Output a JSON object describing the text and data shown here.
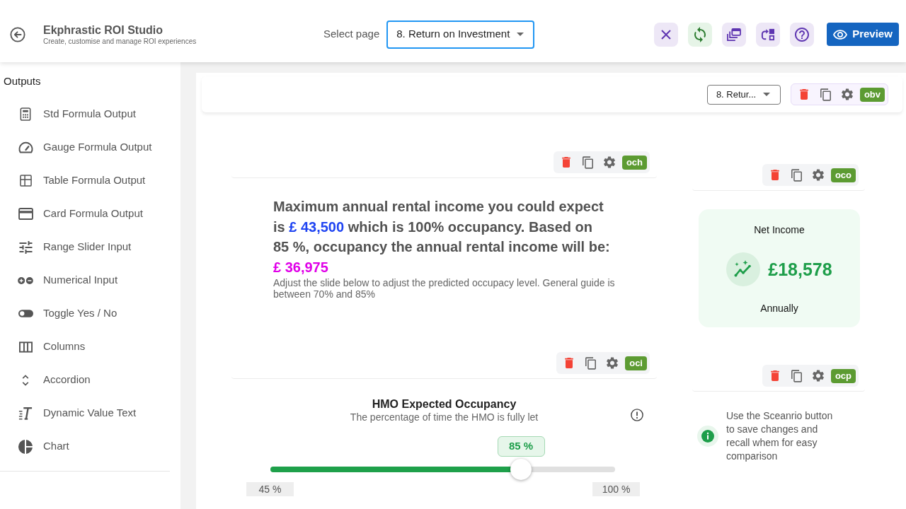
{
  "header": {
    "title": "Ekphrastic ROI Studio",
    "subtitle": "Create, customise and manage ROI experiences",
    "page_select": {
      "label": "Select page",
      "value": "8. Return on Investment"
    },
    "preview_button": "Preview"
  },
  "sidebar": {
    "heading": "Outputs",
    "items": [
      "Std Formula Output",
      "Gauge Formula Output",
      "Table Formula Output",
      "Card Formula Output",
      "Range Slider Input",
      "Numerical Input",
      "Toggle Yes / No",
      "Columns",
      "Accordion",
      "Dynamic Value Text",
      "Chart"
    ]
  },
  "canvas": {
    "page_dropdown": "8. Retur...",
    "page_badge": "obv",
    "blocks": [
      {
        "kind": "text",
        "badge": "och",
        "headline": [
          {
            "kind": "plain",
            "text": "Maximum annual rental income you could expect is "
          },
          {
            "kind": "amount",
            "text": "£ 43,500"
          },
          {
            "kind": "plain",
            "text": " which is 100% occupancy. Based on 85 %, occupancy the annual rental income will be: "
          },
          {
            "kind": "result",
            "text": "£ 36,975"
          }
        ],
        "note": "Adjust the slide below to adjust the predicted occupacy level. General guide is between 70% and 85%"
      },
      {
        "kind": "card",
        "badge": "oco",
        "title": "Net Income",
        "value": "£18,578",
        "caption": "Annually"
      },
      {
        "kind": "slider",
        "badge": "oci",
        "title": "HMO Expected Occupancy",
        "subtitle": "The percentage of time the HMO is fully let",
        "value_label": "85 %",
        "level": 0.727,
        "min_label": "45 %",
        "max_label": "100 %"
      },
      {
        "kind": "info",
        "badge": "ocp",
        "text": "Use the Sceanrio button to save changes and recall whem for easy comparison"
      }
    ]
  }
}
